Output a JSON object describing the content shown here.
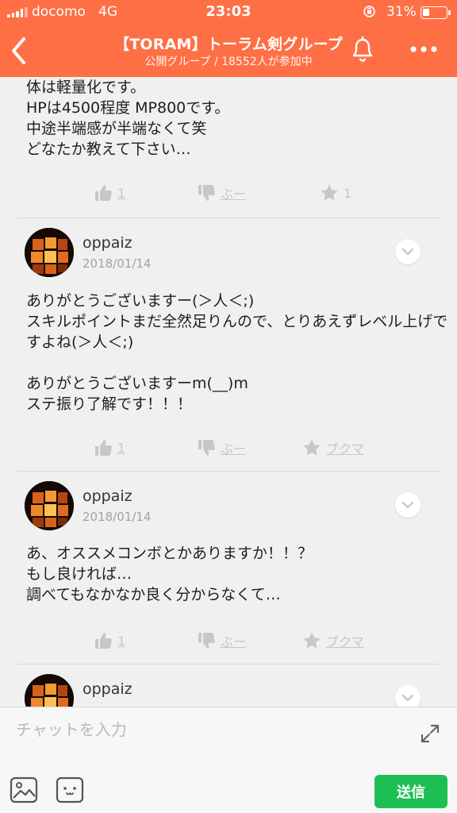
{
  "colors": {
    "header": "#ff6f45",
    "send": "#1dbf52",
    "muted": "#c7c7c7"
  },
  "status": {
    "carrier": "docomo",
    "network": "4G",
    "time": "23:03",
    "battery": "31%",
    "battery_level": 0.31
  },
  "header": {
    "back_icon": "chevron-left-icon",
    "title": "【TORAM】トーラム剣グループ",
    "subtitle": "公開グループ / 18552人が参加中",
    "bell_icon": "bell-icon",
    "more_icon": "more-dots-icon"
  },
  "posts": [
    {
      "text": "体は軽量化です。\nHPは4500程度 MP800です。\n中途半端感が半端なくて笑\nどなたか教えて下さい…",
      "like_count": "1",
      "dislike_label": "ぶー",
      "star_label": "1"
    },
    {
      "author": "oppaiz",
      "date": "2018/01/14",
      "text": "ありがとうございますー(＞人＜;)\nスキルポイントまだ全然足りんので、とりあえずレベル上げですよね(＞人＜;)\n\nありがとうございますーm(__)m\nステ振り了解です！！！",
      "like_count": "1",
      "dislike_label": "ぶー",
      "star_label": "ブクマ"
    },
    {
      "author": "oppaiz",
      "date": "2018/01/14",
      "text": "あ、オススメコンボとかありますか！！？\nもし良ければ…\n調べてもなかなか良く分からなくて…",
      "like_count": "1",
      "dislike_label": "ぶー",
      "star_label": "ブクマ"
    },
    {
      "author": "oppaiz"
    }
  ],
  "composer": {
    "placeholder": "チャットを入力",
    "send_label": "送信",
    "image_icon": "image-icon",
    "sticker_icon": "sticker-icon",
    "expand_icon": "expand-icon"
  }
}
